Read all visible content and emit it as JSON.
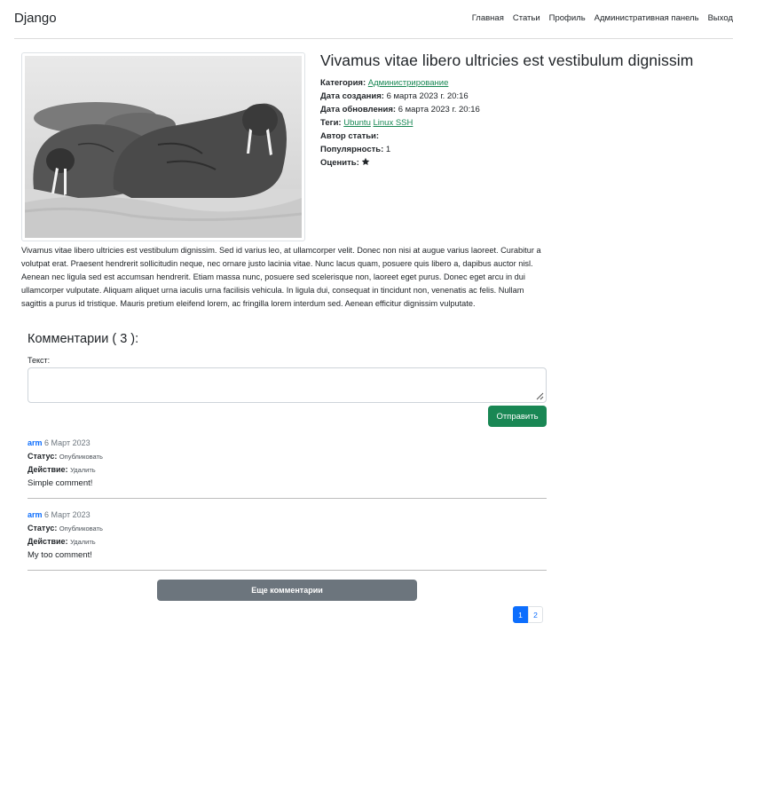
{
  "navbar": {
    "brand": "Django",
    "links": [
      "Главная",
      "Статьи",
      "Профиль",
      "Административная панель",
      "Выход"
    ]
  },
  "article": {
    "image_alt": "Walruses on the shore",
    "title": "Vivamus vitae libero ultricies est vestibulum dignissim",
    "category_label": "Категория:",
    "category": "Администрирование",
    "created_label": "Дата создания:",
    "created": "6 марта 2023 г. 20:16",
    "updated_label": "Дата обновления:",
    "updated": "6 марта 2023 г. 20:16",
    "tags_label": "Теги:",
    "tags": [
      "Ubuntu",
      "Linux SSH"
    ],
    "author_label": "Автор статьи:",
    "popularity_label": "Популярность:",
    "popularity": "1",
    "rate_label": "Оценить:",
    "text": "Vivamus vitae libero ultricies est vestibulum dignissim. Sed id varius leo, at ullamcorper velit. Donec non nisi at augue varius laoreet. Curabitur a volutpat erat. Praesent hendrerit sollicitudin neque, nec ornare justo lacinia vitae. Nunc lacus quam, posuere quis libero a, dapibus auctor nisl. Aenean nec ligula sed est accumsan hendrerit. Etiam massa nunc, posuere sed scelerisque non, laoreet eget purus. Donec eget arcu in dui ullamcorper vulputate. Aliquam aliquet urna iaculis urna facilisis vehicula. In ligula dui, consequat in tincidunt non, venenatis ac felis. Nullam sagittis a purus id tristique. Mauris pretium eleifend lorem, ac fringilla lorem interdum sed. Aenean efficitur dignissim vulputate."
  },
  "comments": {
    "heading": "Комментарии ( 3 ):",
    "text_label": "Текст:",
    "submit_label": "Отправить",
    "items": [
      {
        "author": "arm",
        "date": "6 Март 2023",
        "status_label": "Статус:",
        "status_action": "Опубликовать",
        "action_label": "Действие:",
        "action": "Удалить",
        "text": "Simple comment!"
      },
      {
        "author": "arm",
        "date": "6 Март 2023",
        "status_label": "Статус:",
        "status_action": "Опубликовать",
        "action_label": "Действие:",
        "action": "Удалить",
        "text": "My too comment!"
      }
    ],
    "more_label": "Еще комментарии"
  },
  "pagination": {
    "pages": [
      "1",
      "2"
    ],
    "current": "1"
  },
  "colors": {
    "green": "#198754",
    "blue": "#0d6efd",
    "gray": "#6c757d"
  }
}
